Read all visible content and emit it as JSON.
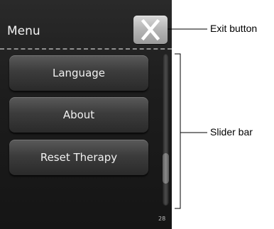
{
  "menu": {
    "title": "Menu",
    "exit_icon": "close-icon",
    "items": [
      {
        "label": "Language"
      },
      {
        "label": "About"
      },
      {
        "label": "Reset Therapy"
      }
    ]
  },
  "slider": {
    "position_fraction": 0.82,
    "visible_fraction": 0.2
  },
  "page_number": "28",
  "annotations": {
    "exit_button": "Exit button",
    "slider_bar": "Slider bar"
  }
}
